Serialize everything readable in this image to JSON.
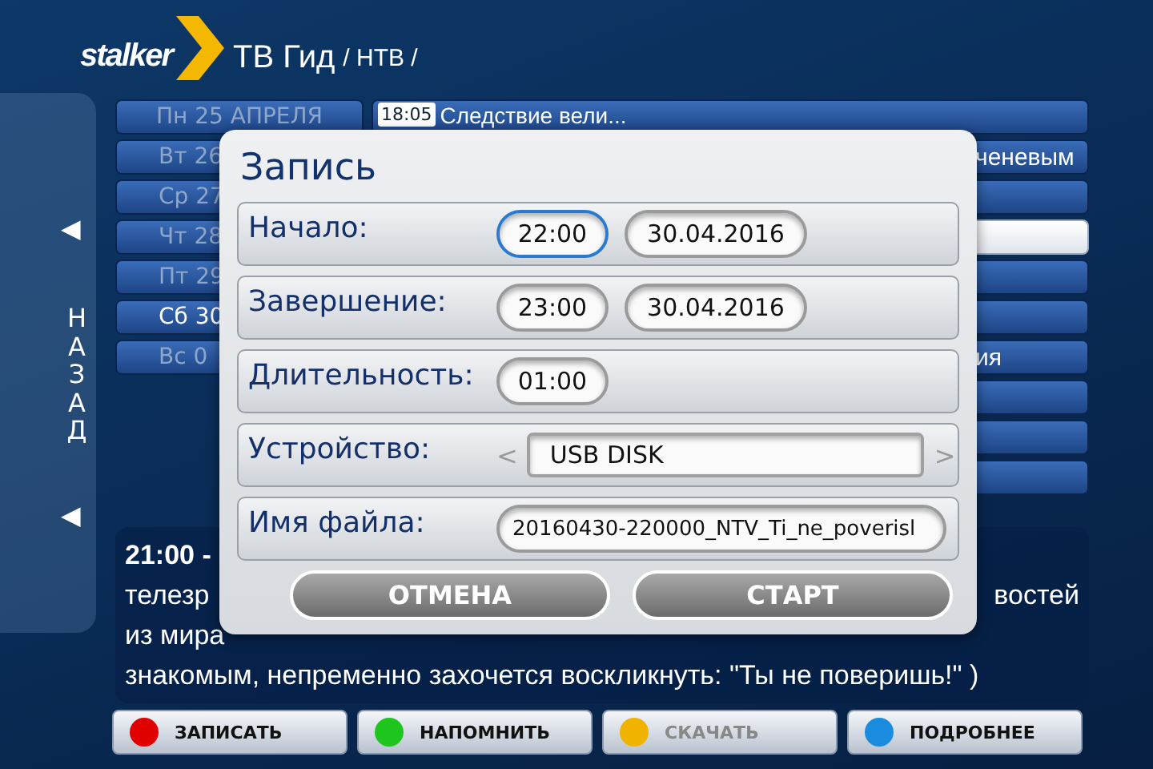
{
  "header": {
    "logo": "stalker",
    "title": "ТВ Гид",
    "path": "/ НТВ /"
  },
  "back": {
    "arrow_top": "◀",
    "label": "НАЗАД",
    "arrow_bottom": "◀"
  },
  "dates": [
    {
      "label": "Пн 25 АПРЕЛЯ",
      "selected": false,
      "kind": "full"
    },
    {
      "label": "Вт 26",
      "selected": false,
      "kind": "partial"
    },
    {
      "label": "Ср 27",
      "selected": false,
      "kind": "partial"
    },
    {
      "label": "Чт 28",
      "selected": false,
      "kind": "partial"
    },
    {
      "label": "Пт 29",
      "selected": false,
      "kind": "partial"
    },
    {
      "label": "Сб 30",
      "selected": true,
      "kind": "partial"
    },
    {
      "label": "Вс 0",
      "selected": false,
      "kind": "partial"
    }
  ],
  "programs": [
    {
      "kind": "full",
      "time": "18:05",
      "title": "Следствие вели...",
      "highlighted": false
    },
    {
      "kind": "partial",
      "title": "ченевым",
      "highlighted": false
    },
    {
      "kind": "empty",
      "highlighted": false
    },
    {
      "kind": "empty",
      "highlighted": true
    },
    {
      "kind": "empty",
      "highlighted": false
    },
    {
      "kind": "empty",
      "highlighted": false
    },
    {
      "kind": "partial",
      "title": "ия",
      "highlighted": false
    },
    {
      "kind": "empty",
      "highlighted": false
    },
    {
      "kind": "empty",
      "highlighted": false
    },
    {
      "kind": "empty",
      "highlighted": false
    }
  ],
  "description": {
    "lines": [
      {
        "left": "21:00 -",
        "bold": true
      },
      {
        "left": "телезр",
        "right": "востей",
        "bold": false
      },
      {
        "left": "из мира",
        "bold": false
      },
      {
        "left": "знакомым, непременно захочется воскликнуть: \"Ты не поверишь!\" )",
        "bold": false
      }
    ]
  },
  "dialog": {
    "title": "Запись",
    "rows": [
      {
        "kind": "fields",
        "label": "Начало:",
        "fields": [
          {
            "value": "22:00",
            "kind": "time",
            "focused": true
          },
          {
            "value": "30.04.2016",
            "kind": "date",
            "focused": false
          }
        ]
      },
      {
        "kind": "fields",
        "label": "Завершение:",
        "fields": [
          {
            "value": "23:00",
            "kind": "time",
            "focused": false
          },
          {
            "value": "30.04.2016",
            "kind": "date",
            "focused": false
          }
        ]
      },
      {
        "kind": "fields",
        "label": "Длительность:",
        "fields": [
          {
            "value": "01:00",
            "kind": "time",
            "focused": false
          }
        ]
      },
      {
        "kind": "select",
        "label": "Устройство:",
        "prev": "<",
        "value": "USB DISK",
        "next": ">"
      },
      {
        "kind": "text",
        "label": "Имя файла:",
        "value": "20160430-220000_NTV_Ti_ne_poverisl"
      }
    ],
    "buttons": [
      "ОТМЕНА",
      "СТАРТ"
    ]
  },
  "actions": [
    {
      "label": "ЗАПИСАТЬ",
      "color": "#e00000",
      "disabled": false
    },
    {
      "label": "НАПОМНИТЬ",
      "color": "#1ec51e",
      "disabled": false
    },
    {
      "label": "СКАЧАТЬ",
      "color": "#f0b400",
      "disabled": true
    },
    {
      "label": "ПОДРОБНЕЕ",
      "color": "#1a8ce0",
      "disabled": false
    }
  ]
}
